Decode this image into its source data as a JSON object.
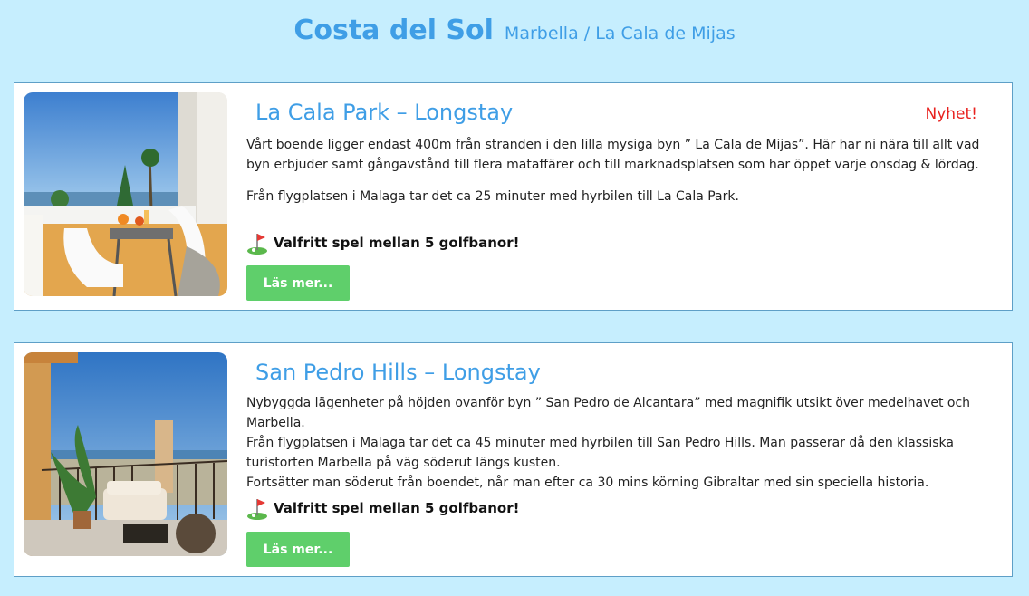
{
  "header": {
    "title": "Costa del Sol",
    "subtitle": "Marbella / La Cala de Mijas"
  },
  "listings": [
    {
      "title": "La Cala Park – Longstay",
      "badge": "Nyhet!",
      "paragraphs": [
        "Vårt boende ligger endast 400m från stranden i den lilla mysiga byn ” La Cala de Mijas”. Här har ni nära till allt vad byn erbjuder samt gångavstånd till flera mataffärer och till marknadsplatsen som har öppet varje onsdag & lördag.",
        "Från flygplatsen i Malaga tar det ca 25 minuter med hyrbilen till La Cala Park."
      ],
      "golf_text": "Valfritt spel mellan 5 golfbanor!",
      "button_label": "Läs mer..."
    },
    {
      "title": "San Pedro Hills – Longstay",
      "paragraphs": [
        "Nybyggda lägenheter på höjden ovanför byn ” San Pedro de Alcantara” med magnifik utsikt över medelhavet och Marbella.",
        "Från flygplatsen i Malaga tar det ca 45 minuter med hyrbilen till San Pedro Hills. Man passerar då den klassiska turistorten Marbella på väg söderut längs kusten.",
        "Fortsätter man söderut från boendet, når man efter ca 30 mins körning Gibraltar med sin speciella historia."
      ],
      "golf_text": "Valfritt spel mellan 5 golfbanor!",
      "button_label": "Läs mer..."
    }
  ],
  "icons": {
    "golf": "golf-flag-icon"
  },
  "colors": {
    "background": "#c6eefe",
    "accent": "#3f9ee6",
    "badge": "#e8211e",
    "button": "#5fcf6b"
  }
}
